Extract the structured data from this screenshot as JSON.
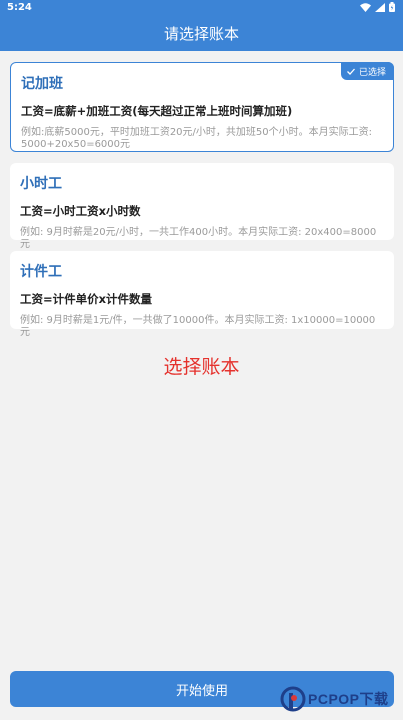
{
  "status_bar": {
    "time": "5:24",
    "icons": [
      "wifi-icon",
      "signal-icon",
      "battery-icon"
    ]
  },
  "app_bar": {
    "title": "请选择账本"
  },
  "cards": [
    {
      "title": "记加班",
      "formula": "工资=底薪+加班工资(每天超过正常上班时间算加班)",
      "example": "例如:底薪5000元，平时加班工资20元/小时，共加班50个小时。本月实际工资: 5000+20x50=6000元",
      "selected": true,
      "badge_label": "已选择"
    },
    {
      "title": "小时工",
      "formula": "工资=小时工资x小时数",
      "example": "例如: 9月时薪是20元/小时，一共工作400小时。本月实际工资: 20x400=8000元",
      "selected": false
    },
    {
      "title": "计件工",
      "formula": "工资=计件单价x计件数量",
      "example": "例如: 9月时薪是1元/件，一共做了10000件。本月实际工资: 1x10000=10000元",
      "selected": false
    }
  ],
  "center_title": "选择账本",
  "start_button": {
    "label": "开始使用"
  },
  "watermark": {
    "text": "PCPOP下载"
  },
  "colors": {
    "primary": "#3c84d6",
    "title_blue": "#2f6fb8",
    "accent_red": "#e5322d",
    "background": "#f2f2f2"
  }
}
